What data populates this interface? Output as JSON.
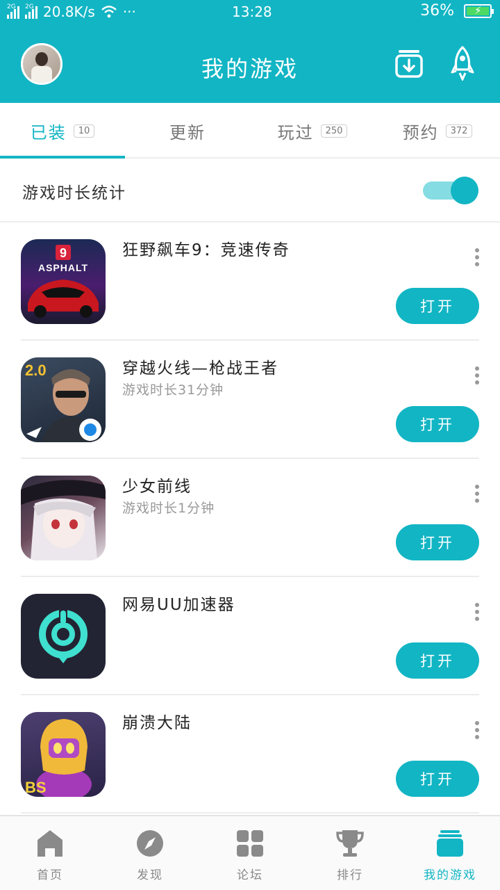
{
  "status_bar": {
    "network_tag_1": "2G",
    "network_tag_2": "2G",
    "speed": "20.8K/s",
    "more": "···",
    "time": "13:28",
    "battery": "36%"
  },
  "app_bar": {
    "title": "我的游戏"
  },
  "tabs": [
    {
      "label": "已装",
      "count": "10"
    },
    {
      "label": "更新",
      "count": ""
    },
    {
      "label": "玩过",
      "count": "250"
    },
    {
      "label": "预约",
      "count": "372"
    }
  ],
  "toggle": {
    "label": "游戏时长统计",
    "on": true
  },
  "games": [
    {
      "name": "狂野飙车9：竞速传奇",
      "playtime": "",
      "open_label": "打开",
      "icon": "asphalt-icon"
    },
    {
      "name": "穿越火线—枪战王者",
      "playtime": "游戏时长31分钟",
      "open_label": "打开",
      "icon": "crossfire-icon"
    },
    {
      "name": "少女前线",
      "playtime": "游戏时长1分钟",
      "open_label": "打开",
      "icon": "girls-frontline-icon"
    },
    {
      "name": "网易UU加速器",
      "playtime": "",
      "open_label": "打开",
      "icon": "uu-accelerator-icon"
    },
    {
      "name": "崩溃大陆",
      "playtime": "",
      "open_label": "打开",
      "icon": "crashlands-icon"
    }
  ],
  "bottom_nav": [
    {
      "label": "首页",
      "icon": "home-icon"
    },
    {
      "label": "发现",
      "icon": "compass-icon"
    },
    {
      "label": "论坛",
      "icon": "grid-icon"
    },
    {
      "label": "排行",
      "icon": "trophy-icon"
    },
    {
      "label": "我的游戏",
      "icon": "games-stack-icon"
    }
  ],
  "colors": {
    "accent": "#12b5c4",
    "accent_light": "#85dde3",
    "text_muted": "#999999"
  }
}
